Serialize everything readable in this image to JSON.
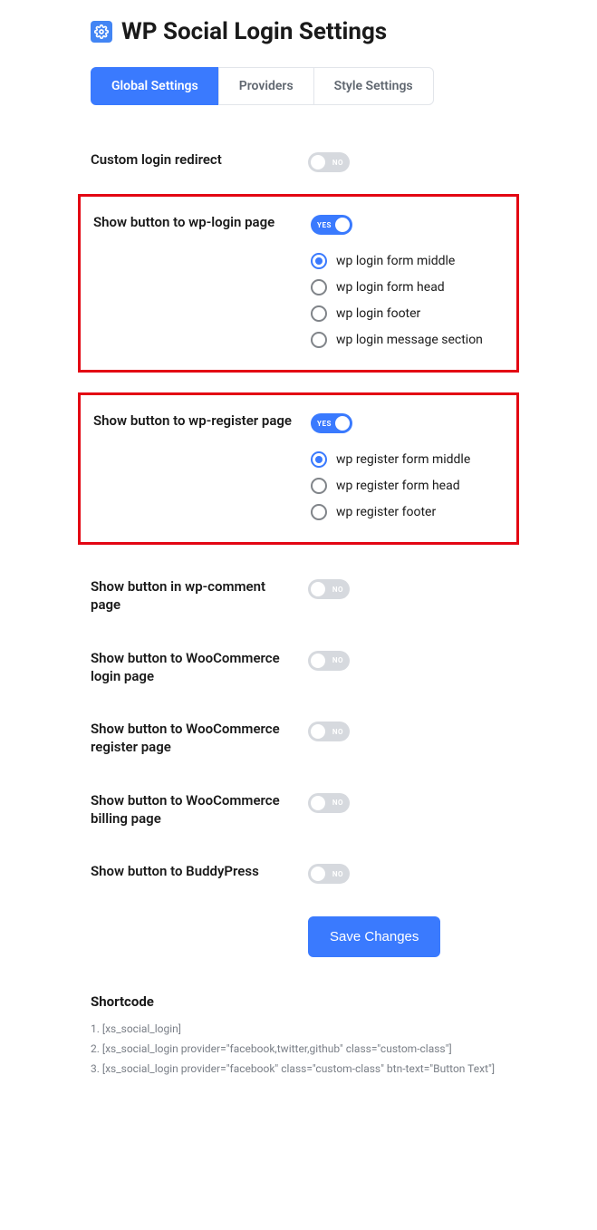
{
  "header": {
    "title": "WP Social Login Settings"
  },
  "tabs": [
    {
      "label": "Global Settings",
      "active": true
    },
    {
      "label": "Providers",
      "active": false
    },
    {
      "label": "Style Settings",
      "active": false
    }
  ],
  "toggle_labels": {
    "on": "YES",
    "off": "NO"
  },
  "rows": {
    "custom_redirect": {
      "label": "Custom login redirect",
      "on": false
    },
    "wp_login": {
      "label": "Show button to wp-login page",
      "on": true,
      "highlight": true,
      "radios": [
        {
          "label": "wp login form middle",
          "selected": true
        },
        {
          "label": "wp login form head",
          "selected": false
        },
        {
          "label": "wp login footer",
          "selected": false
        },
        {
          "label": "wp login message section",
          "selected": false
        }
      ]
    },
    "wp_register": {
      "label": "Show button to wp-register page",
      "on": true,
      "highlight": true,
      "radios": [
        {
          "label": "wp register form middle",
          "selected": true
        },
        {
          "label": "wp register form head",
          "selected": false
        },
        {
          "label": "wp register footer",
          "selected": false
        }
      ]
    },
    "wp_comment": {
      "label": "Show button in wp-comment page",
      "on": false
    },
    "woo_login": {
      "label": "Show button to WooCommerce login page",
      "on": false
    },
    "woo_register": {
      "label": "Show button to WooCommerce register page",
      "on": false
    },
    "woo_billing": {
      "label": "Show button to WooCommerce billing page",
      "on": false
    },
    "buddypress": {
      "label": "Show button to BuddyPress",
      "on": false
    }
  },
  "save_button": "Save Changes",
  "shortcode": {
    "title": "Shortcode",
    "lines": [
      "1. [xs_social_login]",
      "2. [xs_social_login provider=\"facebook,twitter,github\" class=\"custom-class\"]",
      "3. [xs_social_login provider=\"facebook\" class=\"custom-class\" btn-text=\"Button Text\"]"
    ]
  }
}
